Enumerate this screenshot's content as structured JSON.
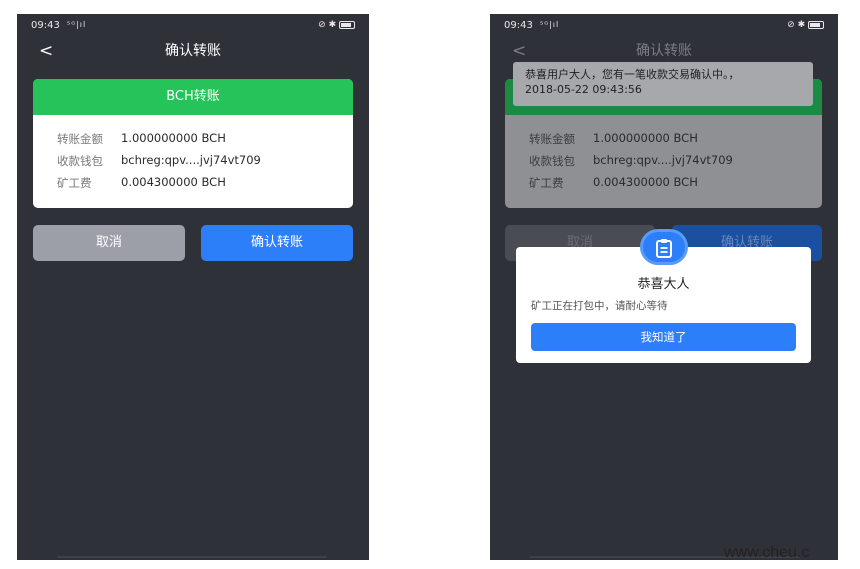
{
  "status": {
    "time": "09:43",
    "net": "⁵ᴳ|ıl",
    "right_icons": "⊘ ✱"
  },
  "nav": {
    "back": "<",
    "title": "确认转账"
  },
  "card": {
    "header": "BCH转账",
    "rows": [
      {
        "key": "转账金额",
        "value": "1.000000000 BCH"
      },
      {
        "key": "收款钱包",
        "value": "bchreg:qpv....jvj74vt709"
      },
      {
        "key": "矿工费",
        "value": "0.004300000 BCH"
      }
    ]
  },
  "buttons": {
    "cancel": "取消",
    "confirm": "确认转账"
  },
  "toast": {
    "line1": "恭喜用户大人，您有一笔收款交易确认中。，",
    "line2": "2018-05-22 09:43:56"
  },
  "dialog": {
    "title": "恭喜大人",
    "message": "矿工正在打包中，请耐心等待",
    "button": "我知道了"
  },
  "watermark": "www.cheu.c",
  "colors": {
    "accent_blue": "#2d7ff9",
    "header_green": "#26c35a",
    "bg_dark": "#2f3138"
  }
}
